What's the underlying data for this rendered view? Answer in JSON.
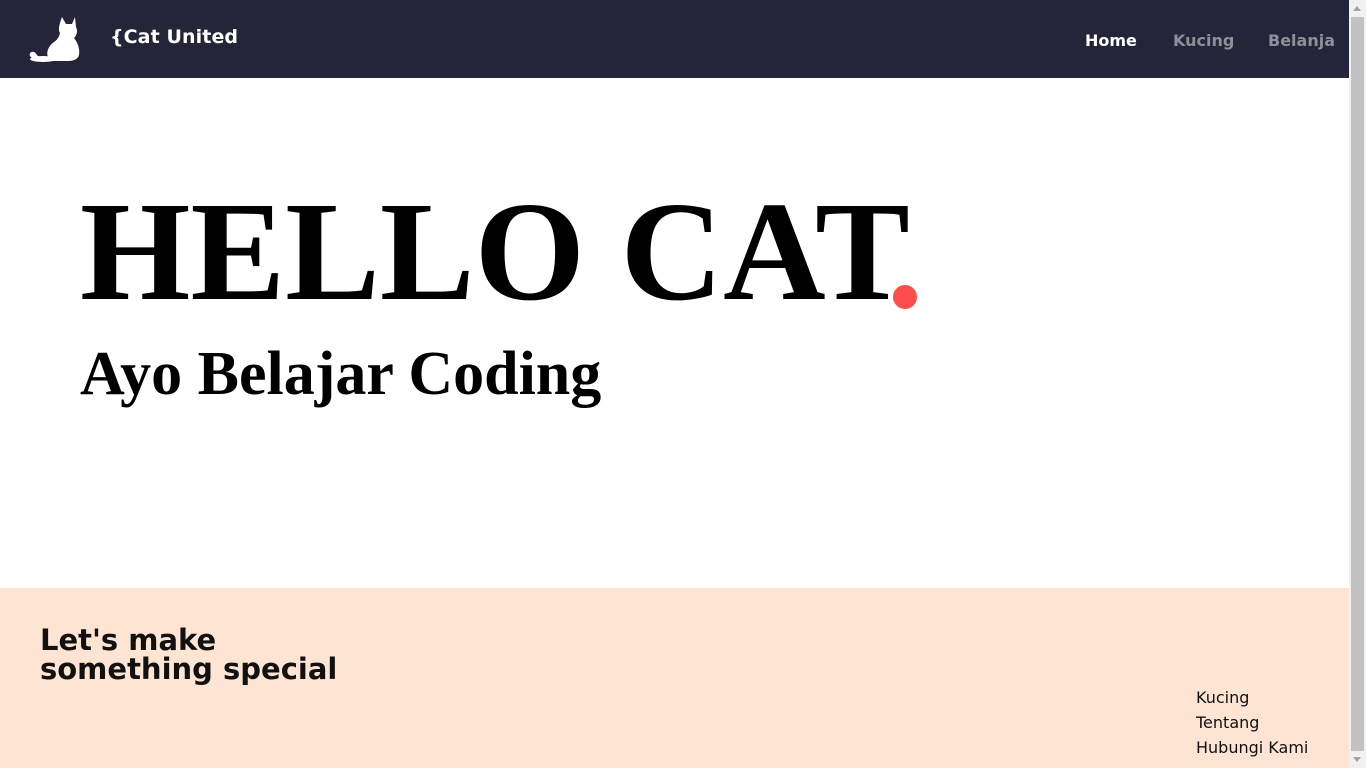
{
  "navbar": {
    "brand": "{Cat United",
    "logo_icon": "cat-silhouette-icon",
    "items": [
      {
        "label": "Home",
        "active": true
      },
      {
        "label": "Kucing",
        "active": false
      },
      {
        "label": "Belanja",
        "active": false
      }
    ]
  },
  "hero": {
    "title": "HELLO CAT",
    "subtitle": "Ayo Belajar Coding",
    "dot_color": "#ff4c4c"
  },
  "footer": {
    "heading_line1": "Let's make",
    "heading_line2": "something special",
    "links": [
      "Kucing",
      "Tentang",
      "Hubungi Kami"
    ]
  },
  "colors": {
    "navbar_bg": "#242539",
    "footer_bg": "#fde4d3",
    "accent": "#ff4c4c"
  }
}
